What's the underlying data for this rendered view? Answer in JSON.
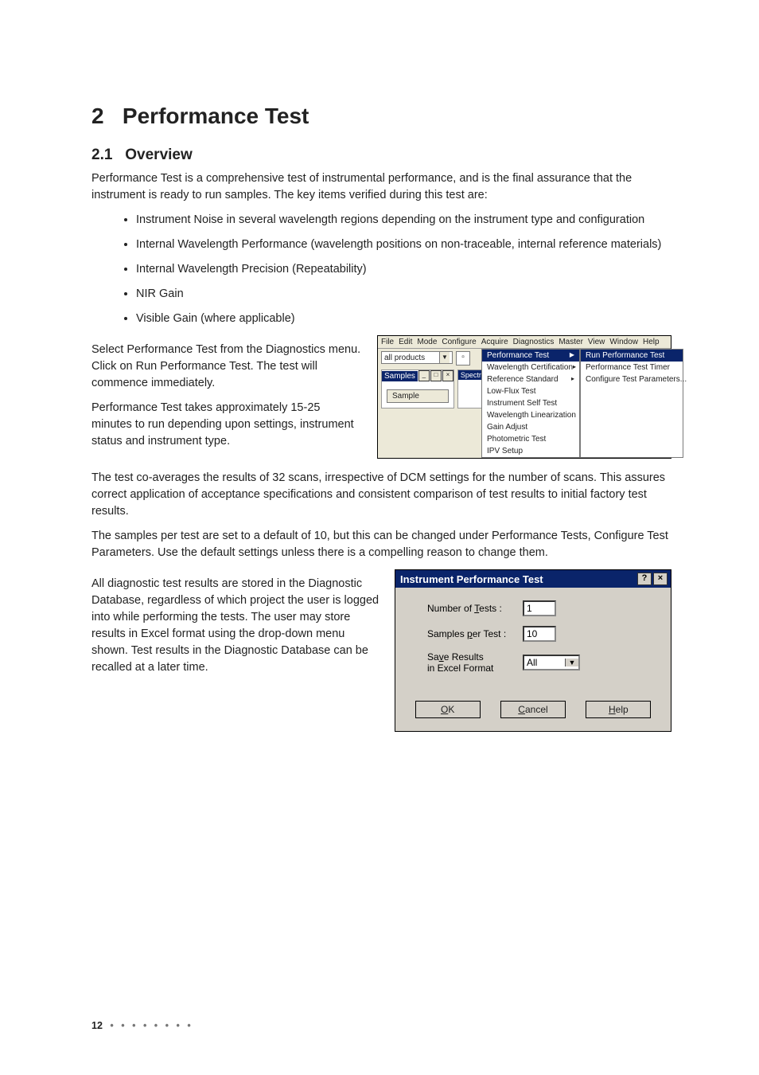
{
  "heading": {
    "num": "2",
    "title": "Performance Test"
  },
  "sub1": {
    "num": "2.1",
    "title": "Overview"
  },
  "p1": "Performance Test is a comprehensive test of instrumental performance, and is the final assurance that the instrument is ready to run samples. The key items verified during this test are:",
  "bullets": [
    "Instrument Noise in several wavelength regions depending on the instrument type and configuration",
    "Internal Wavelength Performance (wavelength positions on non-traceable, internal reference materials)",
    "Internal Wavelength Precision (Repeatability)",
    "NIR Gain",
    "Visible Gain (where applicable)"
  ],
  "p2": "Select Performance Test from the Diagnostics menu. Click on Run Performance Test. The test will commence immediately.",
  "p3": "Performance Test takes approximately 15-25 minutes to run depending upon settings, instrument status and instrument type.",
  "p4": "The test co-averages the results of 32 scans, irrespective of DCM settings for the number of scans. This assures correct application of acceptance specifications and consistent comparison of test results to initial factory test results.",
  "p5": "The samples per test are set to a default of 10, but this can be changed under Performance Tests, Configure Test Parameters. Use the default settings unless there is a compelling reason to change them.",
  "p6": "All diagnostic test results are stored in the Diagnostic Database, regardless of which project the user is logged into while performing the tests. The user may store results in Excel format using the drop-down menu shown. Test results in the Diagnostic Database can be recalled at a later time.",
  "fig_menu": {
    "menubar": [
      "File",
      "Edit",
      "Mode",
      "Configure",
      "Acquire",
      "Diagnostics",
      "Master",
      "View",
      "Window",
      "Help"
    ],
    "combo_value": "all products",
    "panel_samples": "Samples",
    "panel_spectra": "Spectra",
    "sample_btn": "Sample",
    "menu_items": [
      {
        "label": "Performance Test",
        "submenu": true,
        "hi": true
      },
      {
        "label": "Wavelength Certification",
        "submenu": true
      },
      {
        "label": "Reference Standard",
        "submenu": true
      },
      {
        "label": "Low-Flux Test"
      },
      {
        "label": "Instrument Self Test"
      },
      {
        "label": "Wavelength Linearization"
      },
      {
        "label": "Gain Adjust"
      },
      {
        "label": "Photometric Test"
      },
      {
        "label": "IPV Setup"
      }
    ],
    "submenu_items": [
      {
        "label": "Run Performance Test",
        "hi": true
      },
      {
        "label": "Performance Test Timer"
      },
      {
        "label": "Configure Test Parameters..."
      }
    ]
  },
  "fig_dialog": {
    "title": "Instrument Performance Test",
    "num_tests_label": "Number of Tests :",
    "num_tests_value": "1",
    "samples_label": "Samples per Test :",
    "samples_value": "10",
    "save_label_1": "Save Results",
    "save_label_2": "in Excel Format",
    "save_value": "All",
    "ok": "OK",
    "cancel": "Cancel",
    "help": "Help"
  },
  "footer": {
    "page": "12",
    "dots": "• • • • • • • •"
  }
}
